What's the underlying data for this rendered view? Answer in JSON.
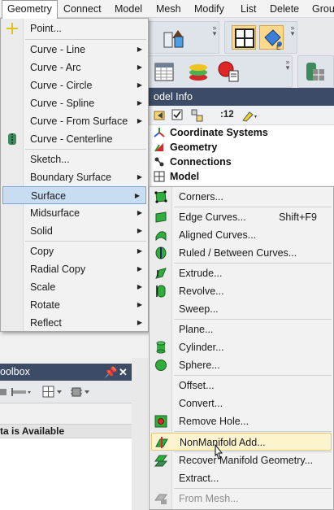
{
  "menubar": {
    "items": [
      {
        "label": "Geometry",
        "open": true
      },
      {
        "label": "Connect"
      },
      {
        "label": "Model"
      },
      {
        "label": "Mesh"
      },
      {
        "label": "Modify"
      },
      {
        "label": "List"
      },
      {
        "label": "Delete"
      },
      {
        "label": "Group"
      }
    ]
  },
  "geometry_menu": {
    "items": [
      {
        "label": "Point...",
        "icon": "point-icon"
      },
      {
        "label": "Curve - Line",
        "submenu": true
      },
      {
        "label": "Curve - Arc",
        "submenu": true
      },
      {
        "label": "Curve - Circle",
        "submenu": true
      },
      {
        "label": "Curve - Spline",
        "submenu": true
      },
      {
        "label": "Curve - From Surface",
        "submenu": true
      },
      {
        "label": "Curve - Centerline",
        "icon": "centerline-icon"
      },
      {
        "label": "Sketch..."
      },
      {
        "label": "Boundary Surface",
        "submenu": true
      },
      {
        "label": "Surface",
        "submenu": true,
        "highlighted": true
      },
      {
        "label": "Midsurface",
        "submenu": true
      },
      {
        "label": "Solid",
        "submenu": true
      },
      {
        "label": "Copy",
        "submenu": true
      },
      {
        "label": "Radial Copy",
        "submenu": true
      },
      {
        "label": "Scale",
        "submenu": true
      },
      {
        "label": "Rotate",
        "submenu": true
      },
      {
        "label": "Reflect",
        "submenu": true
      }
    ]
  },
  "surface_submenu": {
    "items": [
      {
        "label": "Corners...",
        "icon": "corners-icon"
      },
      {
        "label": "Edge Curves...",
        "shortcut": "Shift+F9",
        "icon": "edge-curves-icon"
      },
      {
        "label": "Aligned Curves...",
        "icon": "aligned-curves-icon"
      },
      {
        "label": "Ruled / Between Curves...",
        "icon": "ruled-icon"
      },
      {
        "label": "Extrude...",
        "icon": "extrude-icon"
      },
      {
        "label": "Revolve...",
        "icon": "revolve-icon"
      },
      {
        "label": "Sweep..."
      },
      {
        "label": "Plane..."
      },
      {
        "label": "Cylinder...",
        "icon": "cylinder-icon"
      },
      {
        "label": "Sphere...",
        "icon": "sphere-icon"
      },
      {
        "label": "Offset..."
      },
      {
        "label": "Convert..."
      },
      {
        "label": "Remove Hole...",
        "icon": "remove-hole-icon"
      },
      {
        "label": "NonManifold Add...",
        "icon": "nonmanifold-icon",
        "hover": true
      },
      {
        "label": "Recover Manifold Geometry...",
        "icon": "recover-manifold-icon"
      },
      {
        "label": "Extract..."
      },
      {
        "label": "From Mesh...",
        "icon": "from-mesh-icon",
        "disabled": true
      }
    ]
  },
  "model_info": {
    "title": "odel Info",
    "filter_label": ":12",
    "tree": [
      {
        "label": "Coordinate Systems",
        "icon": "coordinate-systems-icon"
      },
      {
        "label": "Geometry",
        "icon": "geometry-icon"
      },
      {
        "label": "Connections",
        "icon": "connections-icon"
      },
      {
        "label": "Model",
        "icon": "model-icon"
      }
    ]
  },
  "toolbox": {
    "title": "oolbox",
    "empty_text": "ta is Available"
  },
  "colors": {
    "panel_title_bg": "#3d4c66",
    "menu_highlight": "#c8dcf2",
    "menu_hover": "#fcf3cf"
  }
}
